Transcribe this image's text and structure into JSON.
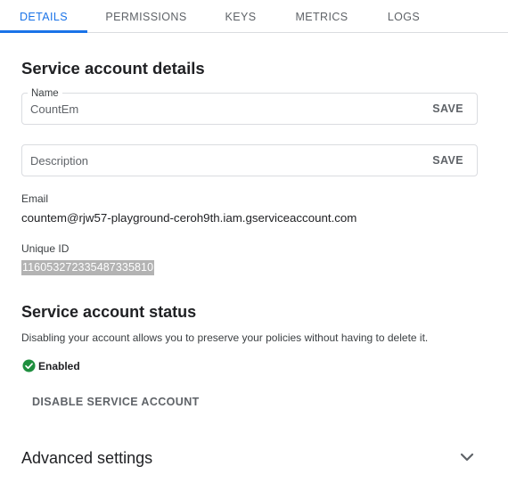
{
  "tabs": [
    {
      "label": "DETAILS",
      "active": true
    },
    {
      "label": "PERMISSIONS",
      "active": false
    },
    {
      "label": "KEYS",
      "active": false
    },
    {
      "label": "METRICS",
      "active": false
    },
    {
      "label": "LOGS",
      "active": false
    }
  ],
  "details": {
    "title": "Service account details",
    "name_label": "Name",
    "name_value": "CountEm",
    "name_save": "SAVE",
    "description_placeholder": "Description",
    "description_save": "SAVE",
    "email_label": "Email",
    "email_value": "countem@rjw57-playground-ceroh9th.iam.gserviceaccount.com",
    "unique_id_label": "Unique ID",
    "unique_id_value": "116053272335487335810"
  },
  "status": {
    "title": "Service account status",
    "description": "Disabling your account allows you to preserve your policies without having to delete it.",
    "state": "Enabled",
    "state_icon": "check-circle-icon",
    "state_color": "#1e8e3e",
    "disable_button": "DISABLE SERVICE ACCOUNT"
  },
  "advanced": {
    "title": "Advanced settings",
    "toggle_icon": "chevron-down-icon"
  },
  "colors": {
    "accent": "#1a73e8",
    "text_primary": "#202124",
    "text_secondary": "#5f6368",
    "border": "#dadce0",
    "selection": "#b3b3b3"
  }
}
